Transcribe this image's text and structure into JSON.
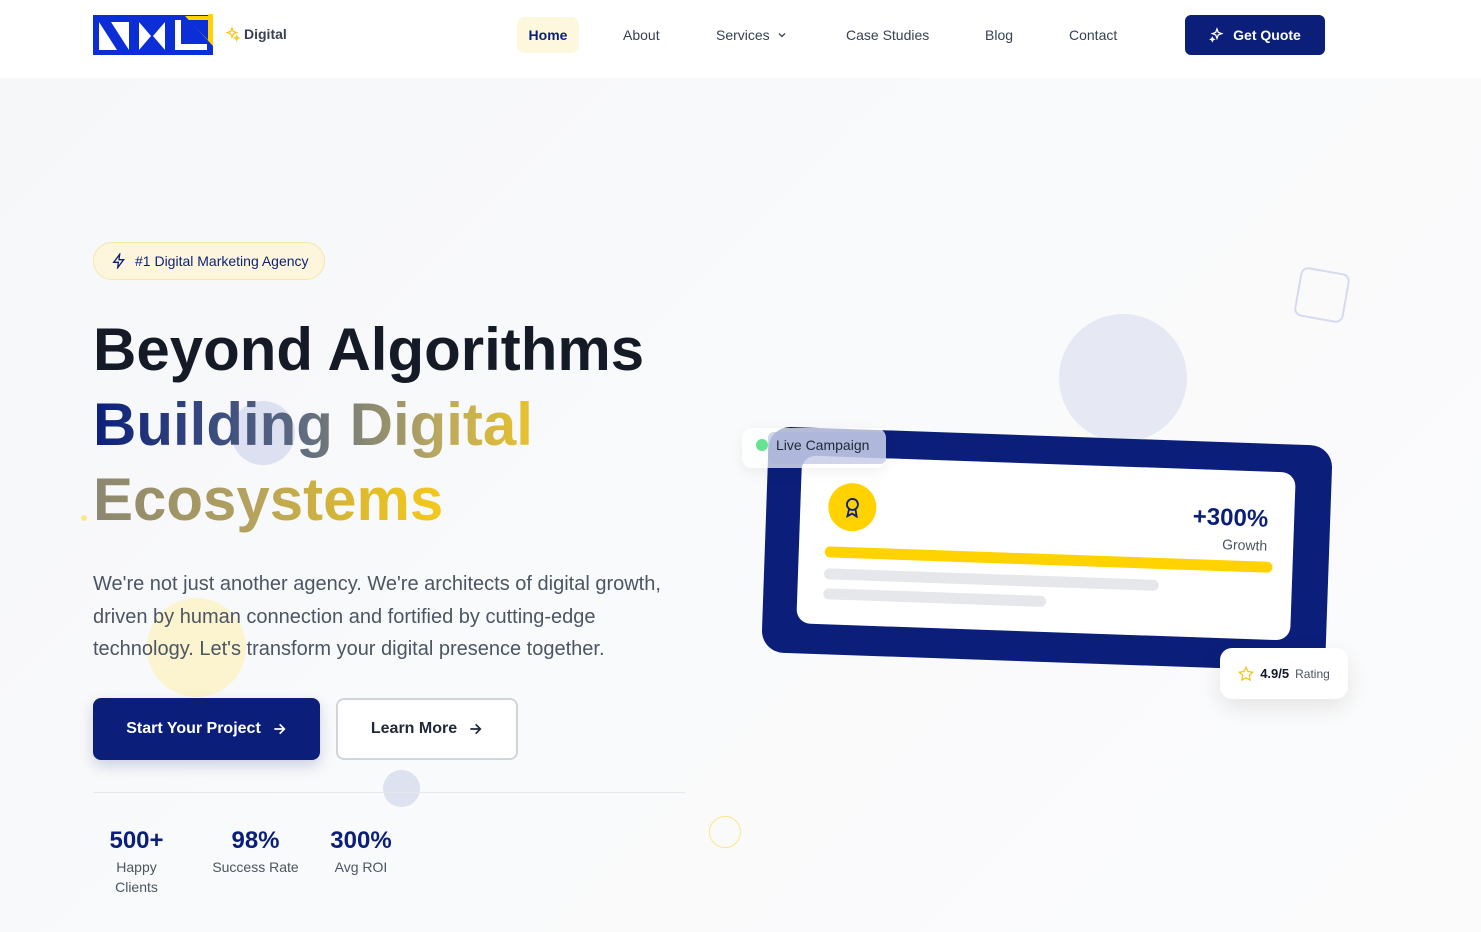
{
  "brand": {
    "logo_text": "NXL",
    "sub_label": "Digital"
  },
  "nav": {
    "items": [
      "Home",
      "About",
      "Services",
      "Case Studies",
      "Blog",
      "Contact"
    ],
    "active": "Home",
    "cta_label": "Get Quote"
  },
  "hero": {
    "badge": "#1 Digital Marketing Agency",
    "headline_line1": "Beyond Algorithms",
    "headline_line2": "Building Digital",
    "headline_line3": "Ecosystems",
    "description": "We're not just another agency. We're architects of digital growth, driven by human connection and fortified by cutting-edge technology. Let's transform your digital presence together.",
    "primary_cta": "Start Your Project",
    "secondary_cta": "Learn More"
  },
  "stats": [
    {
      "value": "500+",
      "label": "Happy Clients"
    },
    {
      "value": "98%",
      "label": "Success Rate"
    },
    {
      "value": "300%",
      "label": "Avg ROI"
    }
  ],
  "visual": {
    "live_label": "Live Campaign",
    "growth_value": "+300%",
    "growth_label": "Growth",
    "rating_value": "4.9/5",
    "rating_label": "Rating"
  },
  "colors": {
    "brand_blue": "#0b1f7a",
    "accent_yellow": "#ffd200",
    "live_green": "#4ade80"
  }
}
